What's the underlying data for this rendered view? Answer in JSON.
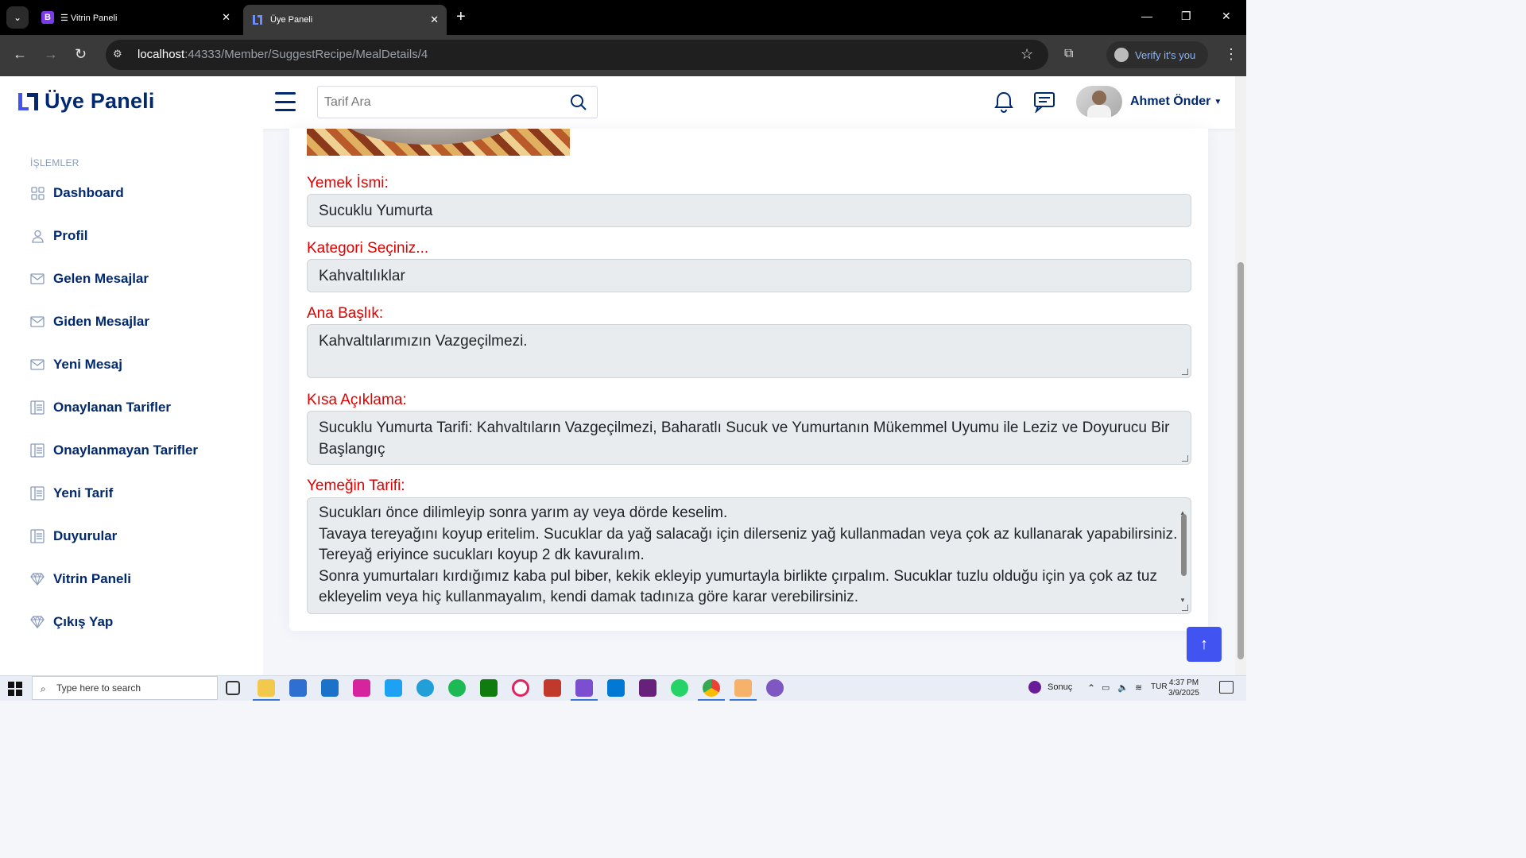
{
  "browser": {
    "tabs": [
      {
        "title": "☰ Vitrin Paneli",
        "favicon": "B"
      },
      {
        "title": "Üye Paneli",
        "favicon": "L"
      }
    ],
    "url": {
      "host": "localhost",
      "path": ":44333/Member/SuggestRecipe/MealDetails/4"
    },
    "verify_label": "Verify it's you"
  },
  "header": {
    "brand": "Üye Paneli",
    "search_placeholder": "Tarif Ara",
    "user_name": "Ahmet Önder",
    "accent": "#4154f1"
  },
  "sidebar": {
    "heading": "İŞLEMLER",
    "items": [
      {
        "label": "Dashboard",
        "icon": "grid-icon"
      },
      {
        "label": "Profil",
        "icon": "person-icon"
      },
      {
        "label": "Gelen Mesajlar",
        "icon": "envelope-icon"
      },
      {
        "label": "Giden Mesajlar",
        "icon": "envelope-icon"
      },
      {
        "label": "Yeni Mesaj",
        "icon": "envelope-icon"
      },
      {
        "label": "Onaylanan Tarifler",
        "icon": "layout-text-icon"
      },
      {
        "label": "Onaylanmayan Tarifler",
        "icon": "layout-text-icon"
      },
      {
        "label": "Yeni Tarif",
        "icon": "layout-text-icon"
      },
      {
        "label": "Duyurular",
        "icon": "layout-text-icon"
      },
      {
        "label": "Vitrin Paneli",
        "icon": "gem-icon"
      },
      {
        "label": "Çıkış Yap",
        "icon": "gem-icon"
      }
    ]
  },
  "form": {
    "meal_name_label": "Yemek İsmi:",
    "meal_name_value": "Sucuklu Yumurta",
    "category_label": "Kategori Seçiniz...",
    "category_value": "Kahvaltılıklar",
    "title_label": "Ana Başlık:",
    "title_value": "Kahvaltılarımızın Vazgeçilmezi.",
    "short_desc_label": "Kısa Açıklama:",
    "short_desc_line1": "Sucuklu Yumurta Tarifi: Kahvaltıların Vazgeçilmezi, Baharatlı Sucuk ve Yumurtanın Mükemmel Uyumu ile Leziz ve Doyurucu Bir",
    "short_desc_line2": "Başlangıç",
    "recipe_label": "Yemeğin Tarifi:",
    "recipe_lines": [
      "Sucukları önce dilimleyip sonra yarım ay veya dörde keselim.",
      "Tavaya tereyağını koyup eritelim. Sucuklar da yağ salacağı için dilerseniz yağ kullanmadan veya çok az kullanarak yapabilirsiniz.",
      "Tereyağ eriyince sucukları koyup 2 dk kavuralım.",
      "Sonra yumurtaları kırdığımız kaba pul biber, kekik ekleyip yumurtayla birlikte çırpalım. Sucuklar tuzlu olduğu için ya çok az tuz",
      "ekleyelim veya hiç kullanmayalım, kendi damak tadınıza göre karar verebilirsiniz."
    ]
  },
  "taskbar": {
    "search_placeholder": "Type here to search",
    "weather_label": "Sonuç",
    "language": "TUR",
    "time": "4:37 PM",
    "date": "3/9/2025"
  }
}
